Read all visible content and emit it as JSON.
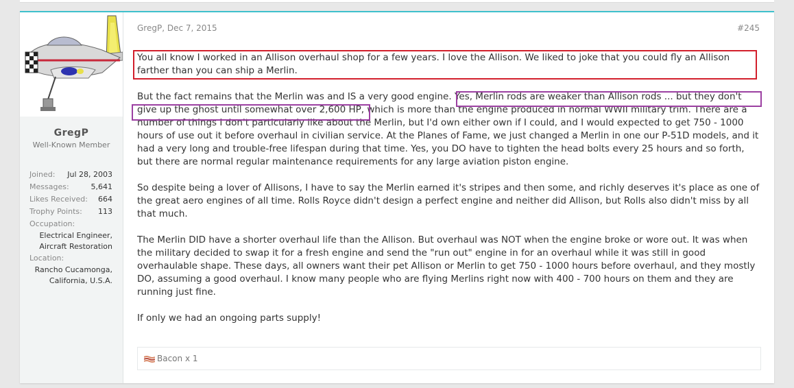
{
  "user": {
    "name": "GregP",
    "title": "Well-Known Member",
    "stats": [
      {
        "label": "Joined:",
        "value": "Jul 28, 2003"
      },
      {
        "label": "Messages:",
        "value": "5,641"
      },
      {
        "label": "Likes Received:",
        "value": "664"
      },
      {
        "label": "Trophy Points:",
        "value": "113"
      }
    ],
    "occupation_label": "Occupation:",
    "occupation_lines": [
      "Electrical Engineer,",
      "Aircraft Restoration"
    ],
    "location_label": "Location:",
    "location_lines": [
      "Rancho Cucamonga,",
      "California, U.S.A."
    ]
  },
  "post": {
    "meta": "GregP, Dec 7, 2015",
    "number": "#245",
    "paragraphs": [
      "You all know I worked in an Allison overhaul shop for a few years. I love the Allison. We liked to joke that you could fly an Allison farther than you can ship a Merlin.",
      "But the fact remains that the Merlin was and IS a very good engine. Yes, Merlin rods are weaker than Allison rods ... but they don't give up the ghost until somewhat over 2,600 HP, which is more than the engine produced in normal WWII military trim. There are a number of things I don't particularly like about the Merlin, but I'd own either own if I could, and I would expected to get 750 - 1000 hours of use out it before overhaul in civilian service. At the Planes of Fame, we just changed a Merlin in one our P-51D models, and it had a very long and trouble-free lifespan during that time. Yes, you DO have to tighten the head bolts every 25 hours and so forth, but there are normal regular maintenance requirements for any large aviation piston engine.",
      "So despite being a lover of Allisons, I have to say the Merlin earned it's stripes and then some, and richly deserves it's place as one of the great aero engines of all time. Rolls Royce didn't design a perfect engine and neither did Allison, but Rolls also didn't miss by all that much.",
      "The Merlin DID have a shorter overhaul life than the Allison. But overhaul was NOT when the engine broke or wore out. It was when the military decided to swap it for a fresh engine and send the \"run out\" engine in for an overhaul while it was still in good overhaulable shape. These days, all owners want their pet Allison or Merlin to get 750 - 1000 hours before overhaul, and they mostly DO, assuming a good overhaul. I know many people who are flying Merlins right now with 400 - 700 hours on them and they are running just fine.",
      "If only we had an ongoing parts supply!"
    ],
    "reaction": "Bacon x 1"
  },
  "colors": {
    "accent": "#3ec0cc",
    "highlight_red": "#d21e2b",
    "highlight_purple": "#9b3fa1"
  },
  "icons": {
    "reaction": "bacon-icon"
  }
}
